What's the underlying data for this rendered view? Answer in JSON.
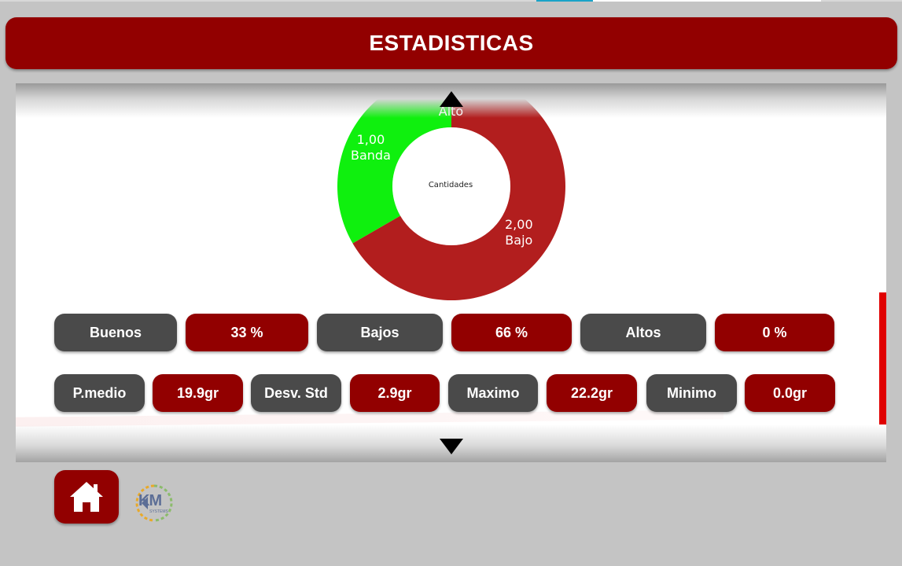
{
  "header": {
    "title": "ESTADISTICAS"
  },
  "chart_data": {
    "type": "pie",
    "center_label": "Cantidades",
    "slices": [
      {
        "label": "Alto",
        "value": 0.0,
        "display": "",
        "color": "#f5f5f5"
      },
      {
        "label": "Bajo",
        "value": 2.0,
        "display": "2,00",
        "color": "#b21e1e"
      },
      {
        "label": "Banda",
        "value": 1.0,
        "display": "1,00",
        "color": "#0ff00e"
      }
    ]
  },
  "stats_row1": [
    {
      "label": "Buenos",
      "value": "33 %"
    },
    {
      "label": "Bajos",
      "value": "66 %"
    },
    {
      "label": "Altos",
      "value": "0 %"
    }
  ],
  "stats_row2": [
    {
      "label": "P.medio",
      "value": "19.9gr"
    },
    {
      "label": "Desv. Std",
      "value": "2.9gr"
    },
    {
      "label": "Maximo",
      "value": "22.2gr"
    },
    {
      "label": "Minimo",
      "value": "0.0gr"
    }
  ],
  "logo": {
    "text": "KM",
    "subtext": "SYSTEMS"
  },
  "colors": {
    "brand_red": "#920000",
    "dark_gray": "#4a4a4a",
    "background": "#c4c4c4",
    "green": "#0ff00e",
    "donut_red": "#b21e1e"
  },
  "icons": {
    "home": "home-icon",
    "scroll_up": "up-arrow-icon",
    "scroll_down": "down-arrow-icon"
  }
}
